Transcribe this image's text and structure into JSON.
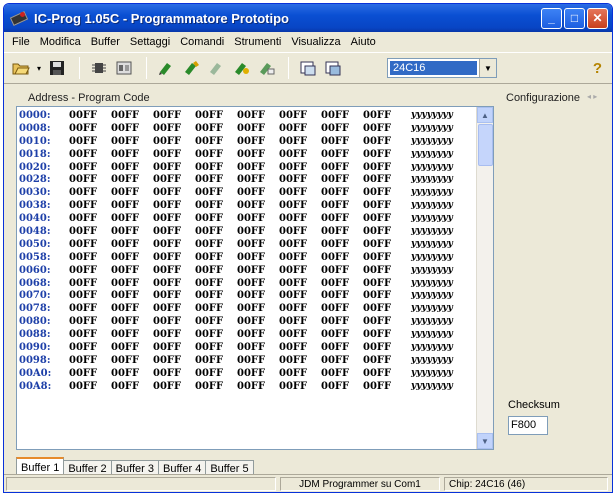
{
  "window": {
    "title": "IC-Prog 1.05C - Programmatore Prototipo",
    "minimize": "_",
    "maximize": "□",
    "close": "✕"
  },
  "menu": [
    "File",
    "Modifica",
    "Buffer",
    "Settaggi",
    "Comandi",
    "Strumenti",
    "Visualizza",
    "Aiuto"
  ],
  "toolbar": {
    "chip_selected": "24C16",
    "icons": [
      "open-file-icon",
      "save-icon",
      "cpu-icon",
      "config-icon",
      "read-chip-icon",
      "program-chip-icon",
      "erase-chip-icon",
      "verify-chip-icon",
      "blank-check-icon",
      "view-hex-icon",
      "view-asm-icon",
      "help-icon"
    ]
  },
  "code_panel": {
    "label": "Address - Program Code",
    "rows": [
      {
        "addr": "0000:",
        "words": [
          "00FF",
          "00FF",
          "00FF",
          "00FF",
          "00FF",
          "00FF",
          "00FF",
          "00FF"
        ],
        "ascii": "yyyyyyyy"
      },
      {
        "addr": "0008:",
        "words": [
          "00FF",
          "00FF",
          "00FF",
          "00FF",
          "00FF",
          "00FF",
          "00FF",
          "00FF"
        ],
        "ascii": "yyyyyyyy"
      },
      {
        "addr": "0010:",
        "words": [
          "00FF",
          "00FF",
          "00FF",
          "00FF",
          "00FF",
          "00FF",
          "00FF",
          "00FF"
        ],
        "ascii": "yyyyyyyy"
      },
      {
        "addr": "0018:",
        "words": [
          "00FF",
          "00FF",
          "00FF",
          "00FF",
          "00FF",
          "00FF",
          "00FF",
          "00FF"
        ],
        "ascii": "yyyyyyyy"
      },
      {
        "addr": "0020:",
        "words": [
          "00FF",
          "00FF",
          "00FF",
          "00FF",
          "00FF",
          "00FF",
          "00FF",
          "00FF"
        ],
        "ascii": "yyyyyyyy"
      },
      {
        "addr": "0028:",
        "words": [
          "00FF",
          "00FF",
          "00FF",
          "00FF",
          "00FF",
          "00FF",
          "00FF",
          "00FF"
        ],
        "ascii": "yyyyyyyy"
      },
      {
        "addr": "0030:",
        "words": [
          "00FF",
          "00FF",
          "00FF",
          "00FF",
          "00FF",
          "00FF",
          "00FF",
          "00FF"
        ],
        "ascii": "yyyyyyyy"
      },
      {
        "addr": "0038:",
        "words": [
          "00FF",
          "00FF",
          "00FF",
          "00FF",
          "00FF",
          "00FF",
          "00FF",
          "00FF"
        ],
        "ascii": "yyyyyyyy"
      },
      {
        "addr": "0040:",
        "words": [
          "00FF",
          "00FF",
          "00FF",
          "00FF",
          "00FF",
          "00FF",
          "00FF",
          "00FF"
        ],
        "ascii": "yyyyyyyy"
      },
      {
        "addr": "0048:",
        "words": [
          "00FF",
          "00FF",
          "00FF",
          "00FF",
          "00FF",
          "00FF",
          "00FF",
          "00FF"
        ],
        "ascii": "yyyyyyyy"
      },
      {
        "addr": "0050:",
        "words": [
          "00FF",
          "00FF",
          "00FF",
          "00FF",
          "00FF",
          "00FF",
          "00FF",
          "00FF"
        ],
        "ascii": "yyyyyyyy"
      },
      {
        "addr": "0058:",
        "words": [
          "00FF",
          "00FF",
          "00FF",
          "00FF",
          "00FF",
          "00FF",
          "00FF",
          "00FF"
        ],
        "ascii": "yyyyyyyy"
      },
      {
        "addr": "0060:",
        "words": [
          "00FF",
          "00FF",
          "00FF",
          "00FF",
          "00FF",
          "00FF",
          "00FF",
          "00FF"
        ],
        "ascii": "yyyyyyyy"
      },
      {
        "addr": "0068:",
        "words": [
          "00FF",
          "00FF",
          "00FF",
          "00FF",
          "00FF",
          "00FF",
          "00FF",
          "00FF"
        ],
        "ascii": "yyyyyyyy"
      },
      {
        "addr": "0070:",
        "words": [
          "00FF",
          "00FF",
          "00FF",
          "00FF",
          "00FF",
          "00FF",
          "00FF",
          "00FF"
        ],
        "ascii": "yyyyyyyy"
      },
      {
        "addr": "0078:",
        "words": [
          "00FF",
          "00FF",
          "00FF",
          "00FF",
          "00FF",
          "00FF",
          "00FF",
          "00FF"
        ],
        "ascii": "yyyyyyyy"
      },
      {
        "addr": "0080:",
        "words": [
          "00FF",
          "00FF",
          "00FF",
          "00FF",
          "00FF",
          "00FF",
          "00FF",
          "00FF"
        ],
        "ascii": "yyyyyyyy"
      },
      {
        "addr": "0088:",
        "words": [
          "00FF",
          "00FF",
          "00FF",
          "00FF",
          "00FF",
          "00FF",
          "00FF",
          "00FF"
        ],
        "ascii": "yyyyyyyy"
      },
      {
        "addr": "0090:",
        "words": [
          "00FF",
          "00FF",
          "00FF",
          "00FF",
          "00FF",
          "00FF",
          "00FF",
          "00FF"
        ],
        "ascii": "yyyyyyyy"
      },
      {
        "addr": "0098:",
        "words": [
          "00FF",
          "00FF",
          "00FF",
          "00FF",
          "00FF",
          "00FF",
          "00FF",
          "00FF"
        ],
        "ascii": "yyyyyyyy"
      },
      {
        "addr": "00A0:",
        "words": [
          "00FF",
          "00FF",
          "00FF",
          "00FF",
          "00FF",
          "00FF",
          "00FF",
          "00FF"
        ],
        "ascii": "yyyyyyyy"
      },
      {
        "addr": "00A8:",
        "words": [
          "00FF",
          "00FF",
          "00FF",
          "00FF",
          "00FF",
          "00FF",
          "00FF",
          "00FF"
        ],
        "ascii": "yyyyyyyy"
      }
    ]
  },
  "config_panel": {
    "label": "Configurazione",
    "checksum_label": "Checksum",
    "checksum_value": "F800"
  },
  "tabs": [
    "Buffer 1",
    "Buffer 2",
    "Buffer 3",
    "Buffer 4",
    "Buffer 5"
  ],
  "status": {
    "programmer": "JDM Programmer su Com1",
    "chip": "Chip: 24C16  (46)"
  },
  "colors": {
    "titlebar": "#0a4fd3",
    "address_text": "#1d3fa8",
    "selected_chip_bg": "#316ac5",
    "active_tab_accent": "#e68b2c"
  }
}
